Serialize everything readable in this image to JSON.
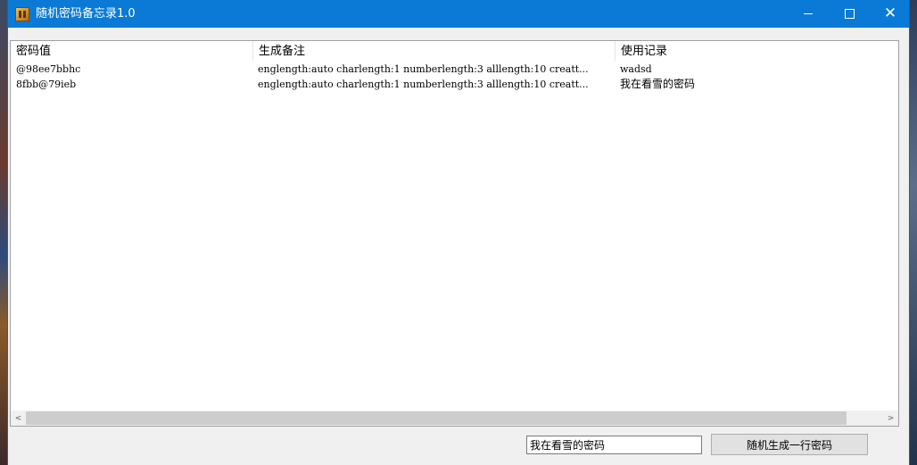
{
  "window": {
    "title": "随机密码备忘录1.0",
    "controls": {
      "minimize": "",
      "maximize": "",
      "close": "✕"
    }
  },
  "list": {
    "columns": [
      "密码值",
      "生成备注",
      "使用记录"
    ],
    "rows": [
      {
        "password": "@98ee7bbhc",
        "note": "englength:auto charlength:1 numberlength:3 alllength:10 creatt...",
        "usage": "wadsd"
      },
      {
        "password": "8fbb@79ieb",
        "note": "englength:auto charlength:1 numberlength:3 alllength:10 creatt...",
        "usage": "我在看雪的密码"
      }
    ]
  },
  "scrollbar": {
    "left_arrow": "<",
    "right_arrow": ">"
  },
  "controls": {
    "note_value": "我在看雪的密码",
    "generate_label": "随机生成一行密码"
  },
  "colors": {
    "titlebar": "#0a7ad6",
    "window_bg": "#f0f0f0"
  }
}
